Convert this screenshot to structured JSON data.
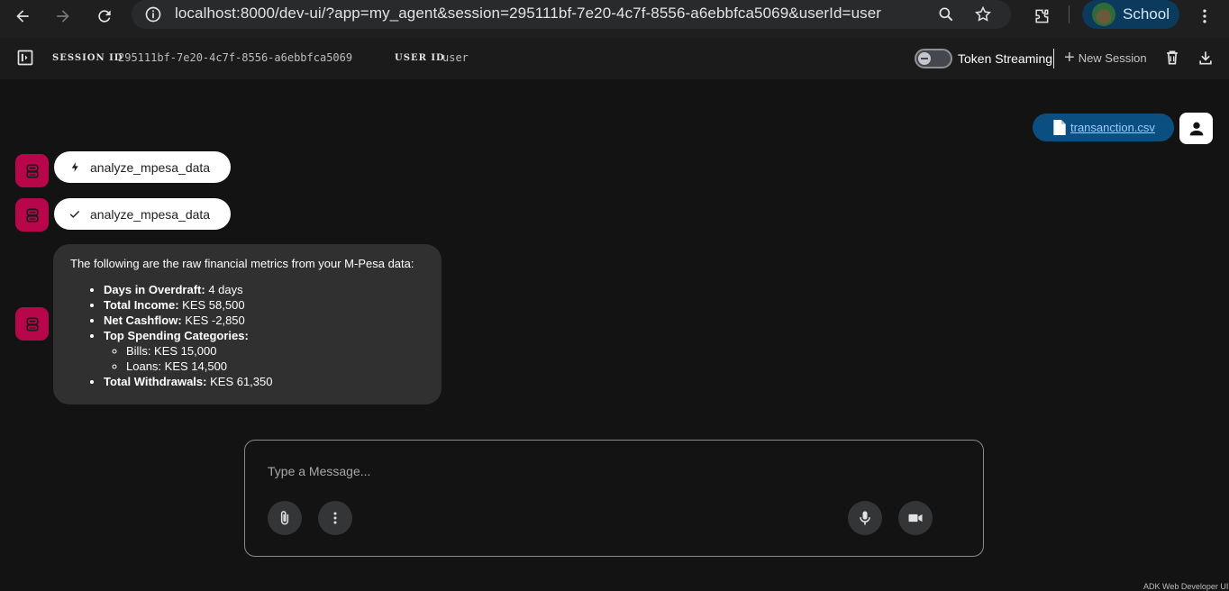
{
  "browser": {
    "url": "localhost:8000/dev-ui/?app=my_agent&session=295111bf-7e20-4c7f-8556-a6ebbfca5069&userId=user",
    "profile_name": "School"
  },
  "toolbar": {
    "session_label": "SESSION ID",
    "session_id": "295111bf-7e20-4c7f-8556-a6ebbfca5069",
    "user_label": "USER ID",
    "user_id": "user",
    "token_streaming_label": "Token Streaming",
    "token_streaming_on": false,
    "new_session_label": "New Session"
  },
  "chat": {
    "user_attachment": "transanction.csv",
    "tool_call": {
      "name": "analyze_mpesa_data",
      "icon": "bolt-icon"
    },
    "tool_result": {
      "name": "analyze_mpesa_data",
      "icon": "check-icon"
    },
    "response": {
      "intro": "The following are the raw financial metrics from your M-Pesa data:",
      "items": [
        {
          "label": "Days in Overdraft:",
          "value": " 4 days"
        },
        {
          "label": "Total Income:",
          "value": " KES 58,500"
        },
        {
          "label": "Net Cashflow:",
          "value": " KES -2,850"
        },
        {
          "label": "Top Spending Categories:",
          "value": ""
        },
        {
          "label": "Total Withdrawals:",
          "value": " KES 61,350"
        }
      ],
      "sub_items": [
        "Bills: KES 15,000",
        "Loans: KES 14,500"
      ]
    }
  },
  "input": {
    "placeholder": "Type a Message..."
  },
  "footer": "ADK Web Developer UI",
  "colors": {
    "accent_bot": "#b8064a",
    "user_bubble": "#0b4f80",
    "background": "#131313"
  }
}
